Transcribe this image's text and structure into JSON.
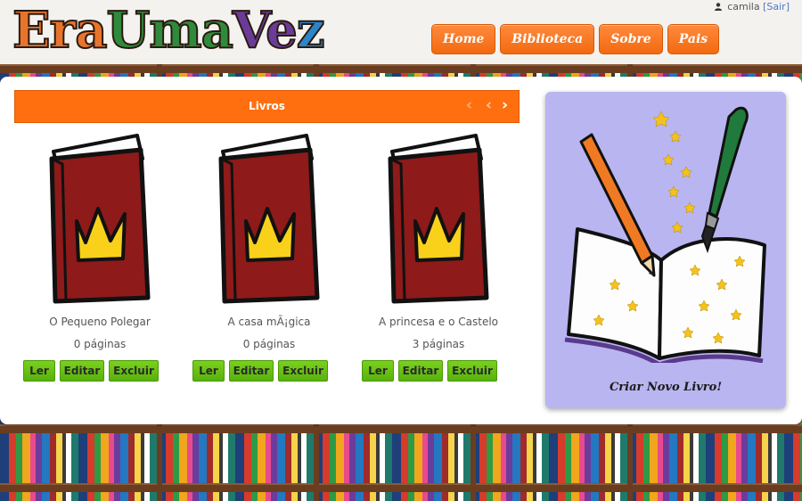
{
  "header": {
    "logo": [
      "Era",
      "Uma",
      "Ve",
      "z"
    ],
    "user": "camila",
    "logout_label": "[Sair]",
    "nav": [
      {
        "label": "Home"
      },
      {
        "label": "Biblioteca"
      },
      {
        "label": "Sobre"
      },
      {
        "label": "Pais"
      }
    ]
  },
  "books_section": {
    "title": "Livros",
    "controls": {
      "dim": "‹",
      "prev": "‹",
      "next": "›"
    },
    "books": [
      {
        "title": "O Pequeno Polegar",
        "pages": "0 páginas",
        "read": "Ler",
        "edit": "Editar",
        "delete": "Excluir"
      },
      {
        "title": "A casa mÃ¡gica",
        "pages": "0 páginas",
        "read": "Ler",
        "edit": "Editar",
        "delete": "Excluir"
      },
      {
        "title": "A princesa e o Castelo",
        "pages": "3 páginas",
        "read": "Ler",
        "edit": "Editar",
        "delete": "Excluir"
      }
    ]
  },
  "create_book": {
    "label": "Criar Novo Livro!"
  },
  "colors": {
    "orange": "#ff6f0f",
    "green_button": "#6cc314",
    "book_red": "#8e1a1a",
    "crown_yellow": "#f9d11a",
    "create_bg": "#b9b5f0"
  },
  "icons": [
    "user-icon",
    "chevron-left-icon",
    "chevron-right-icon",
    "book-cover-icon",
    "crown-icon",
    "pencil-icon",
    "brush-icon",
    "open-book-icon"
  ]
}
